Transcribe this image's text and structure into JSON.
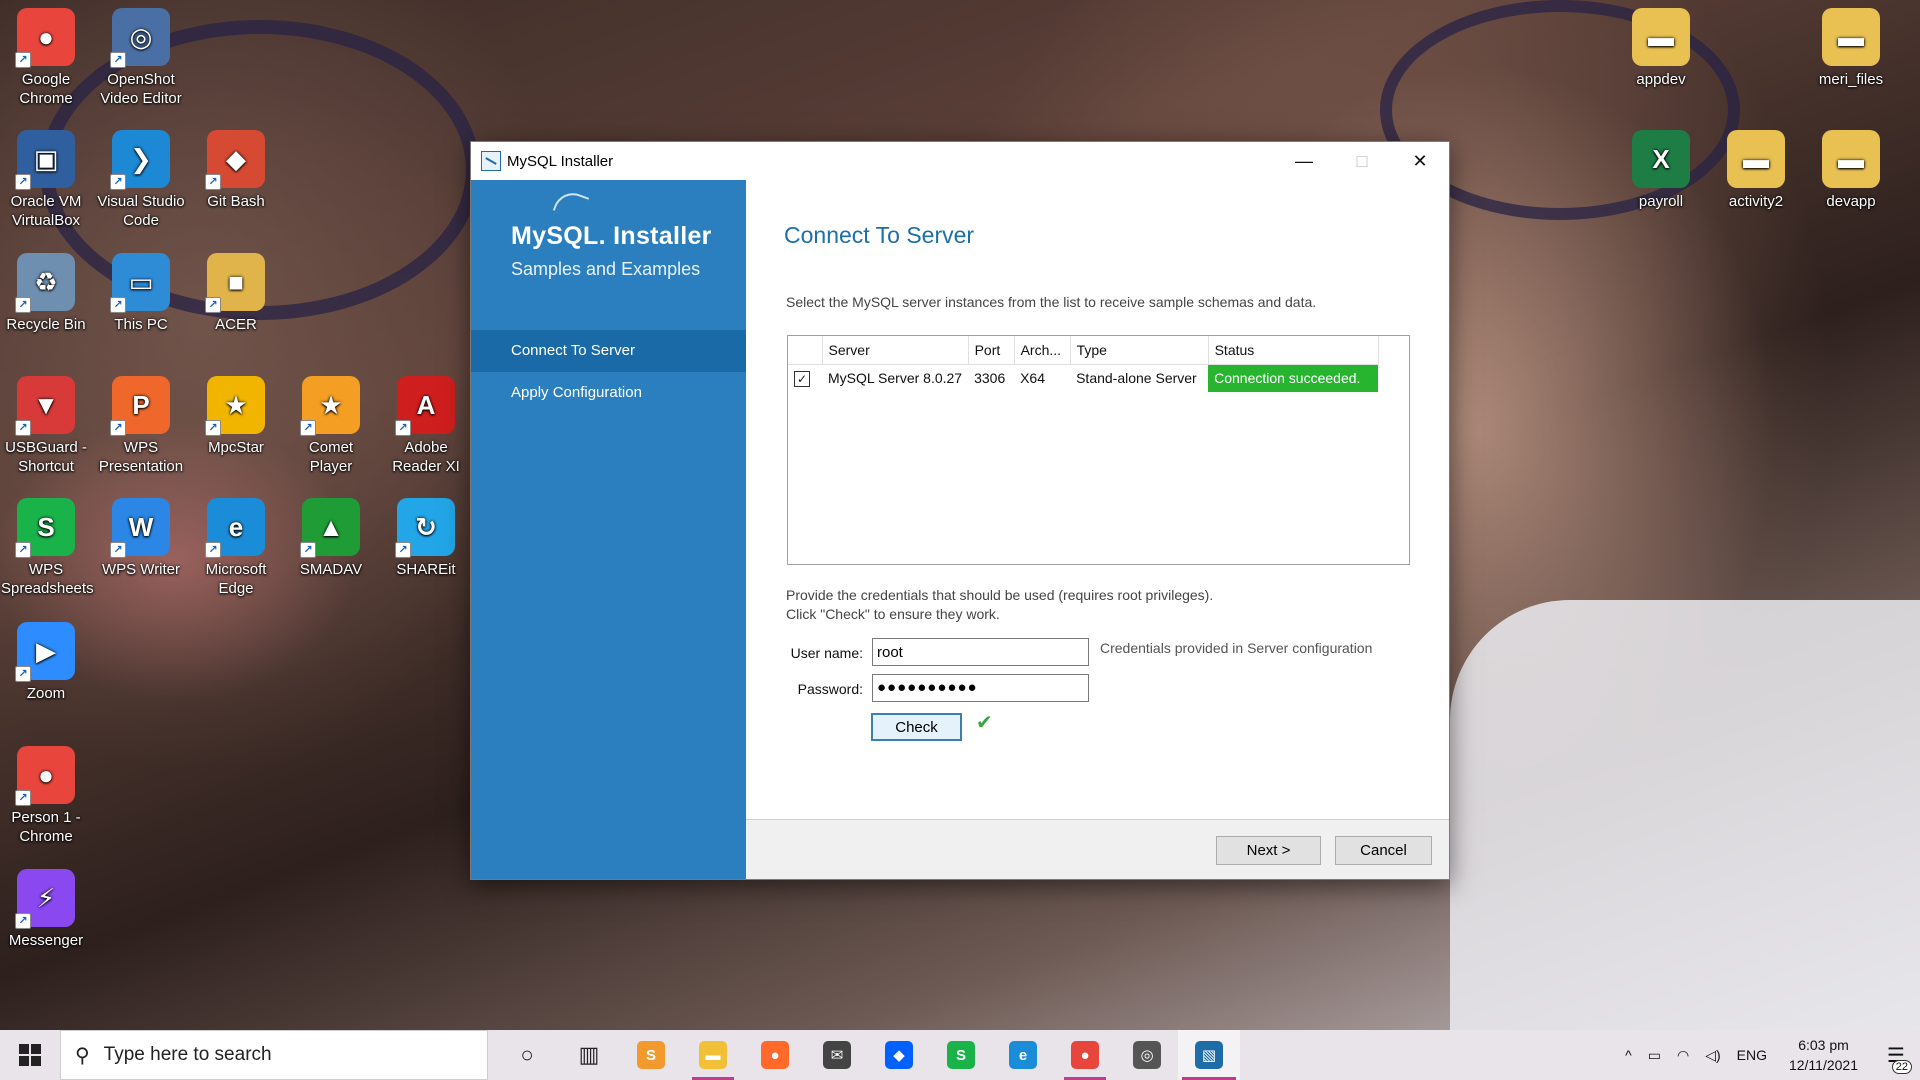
{
  "desktop": {
    "icons_left": [
      {
        "label": "Google Chrome",
        "glyph": "●",
        "color": "#e8453c"
      },
      {
        "label": "OpenShot Video Editor",
        "glyph": "◎",
        "color": "#4a6fa5"
      },
      {
        "label": "Oracle VM VirtualBox",
        "glyph": "▣",
        "color": "#2f5f9e"
      },
      {
        "label": "Visual Studio Code",
        "glyph": "❯",
        "color": "#1d88d3"
      },
      {
        "label": "Git Bash",
        "glyph": "◆",
        "color": "#d64933"
      },
      {
        "label": "Recycle Bin",
        "glyph": "♻",
        "color": "#6f8fb0"
      },
      {
        "label": "This PC",
        "glyph": "▭",
        "color": "#2e8bd6"
      },
      {
        "label": "ACER",
        "glyph": "■",
        "color": "#e0b44a"
      },
      {
        "label": "USBGuard - Shortcut",
        "glyph": "▼",
        "color": "#d83a3a"
      },
      {
        "label": "WPS Presentation",
        "glyph": "P",
        "color": "#f0672b"
      },
      {
        "label": "MpcStar",
        "glyph": "★",
        "color": "#f1b500"
      },
      {
        "label": "Comet Player",
        "glyph": "★",
        "color": "#f59e24"
      },
      {
        "label": "Adobe Reader XI",
        "glyph": "A",
        "color": "#cf1e1e"
      },
      {
        "label": "WPS Spreadsheets",
        "glyph": "S",
        "color": "#1ab34a"
      },
      {
        "label": "WPS Writer",
        "glyph": "W",
        "color": "#2b86e5"
      },
      {
        "label": "Microsoft Edge",
        "glyph": "e",
        "color": "#1b8dd8"
      },
      {
        "label": "SMADAV",
        "glyph": "▲",
        "color": "#1f9c35"
      },
      {
        "label": "SHAREit",
        "glyph": "↻",
        "color": "#22a6e8"
      },
      {
        "label": "Zoom",
        "glyph": "▶",
        "color": "#2d8cff"
      },
      {
        "label": "Person 1 - Chrome",
        "glyph": "●",
        "color": "#e8453c"
      },
      {
        "label": "Messenger",
        "glyph": "⚡",
        "color": "#8a48f0"
      }
    ],
    "icons_right": [
      {
        "label": "appdev",
        "glyph": "▬",
        "color": "#e9c052"
      },
      {
        "label": "meri_files",
        "glyph": "▬",
        "color": "#e9c052"
      },
      {
        "label": "payroll",
        "glyph": "X",
        "color": "#1e7d45"
      },
      {
        "label": "activity2",
        "glyph": "▬",
        "color": "#e9c052"
      },
      {
        "label": "devapp",
        "glyph": "▬",
        "color": "#e9c052"
      }
    ]
  },
  "window": {
    "title": "MySQL Installer",
    "minimize": "—",
    "maximize": "□",
    "close": "✕"
  },
  "sidebar": {
    "logo_main": "MySQL",
    "logo_suffix": "Installer",
    "logo_sub": "Samples and Examples",
    "nav": [
      {
        "label": "Connect To Server",
        "active": true
      },
      {
        "label": "Apply Configuration",
        "active": false
      }
    ]
  },
  "main": {
    "title": "Connect To Server",
    "description": "Select the MySQL server instances from the list to receive sample schemas and data.",
    "columns": [
      "",
      "Server",
      "Port",
      "Arch...",
      "Type",
      "Status"
    ],
    "rows": [
      {
        "checked": true,
        "server": "MySQL Server 8.0.27",
        "port": "3306",
        "arch": "X64",
        "type": "Stand-alone Server",
        "status": "Connection succeeded."
      }
    ],
    "cred_note_1": "Provide the credentials that should be used (requires root privileges).",
    "cred_note_2": "Click \"Check\" to ensure they work.",
    "username_label": "User name:",
    "username_value": "root",
    "password_label": "Password:",
    "password_value": "●●●●●●●●●●",
    "credentials_hint": "Credentials provided in Server configuration",
    "check_button": "Check",
    "check_result": "✔"
  },
  "footer": {
    "next_button": "Next >",
    "cancel_button": "Cancel"
  },
  "taskbar": {
    "search_placeholder": "Type here to search",
    "apps": [
      {
        "name": "cortana",
        "glyph": "○",
        "color": "#222222",
        "running": false
      },
      {
        "name": "task-view",
        "glyph": "▥",
        "color": "#222222",
        "running": false
      },
      {
        "name": "sublime-text",
        "glyph": "S",
        "color": "#f29a2e",
        "running": false
      },
      {
        "name": "file-explorer",
        "glyph": "▬",
        "color": "#f2c037",
        "running": true
      },
      {
        "name": "firefox",
        "glyph": "●",
        "color": "#ff6a2b",
        "running": false
      },
      {
        "name": "mail",
        "glyph": "✉",
        "color": "#444444",
        "running": false
      },
      {
        "name": "dropbox",
        "glyph": "◆",
        "color": "#0061fe",
        "running": false
      },
      {
        "name": "wps-office",
        "glyph": "S",
        "color": "#1ab34a",
        "running": false
      },
      {
        "name": "edge",
        "glyph": "e",
        "color": "#1b8dd8",
        "running": false
      },
      {
        "name": "chrome",
        "glyph": "●",
        "color": "#e8453c",
        "running": true
      },
      {
        "name": "media-player",
        "glyph": "◎",
        "color": "#555555",
        "running": false
      },
      {
        "name": "mysql-installer",
        "glyph": "▧",
        "color": "#1f6da8",
        "running": true,
        "active": true
      }
    ],
    "tray_chevron": "^",
    "battery": "▭",
    "wifi": "◠",
    "volume": "◁)",
    "language": "ENG",
    "time": "6:03 pm",
    "date": "12/11/2021",
    "notifications": "22"
  }
}
